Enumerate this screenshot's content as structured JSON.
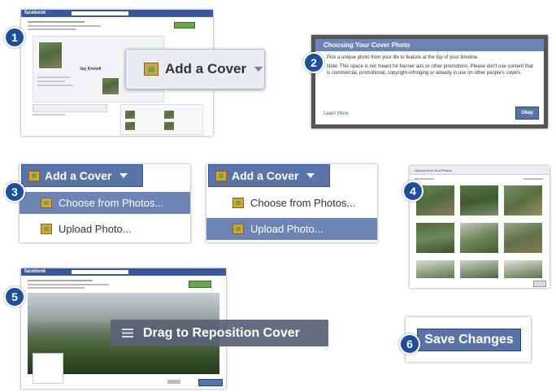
{
  "panel1": {
    "brand": "facebook",
    "add_cover_label": "Add a Cover",
    "profile_name": "Jay Kinnell"
  },
  "panel2": {
    "dialog_title": "Choosing Your Cover Photo",
    "dialog_text_1": "Pick a unique photo from your life to feature at the top of your timeline.",
    "dialog_text_2": "Note: This space is not meant for banner ads or other promotions. Please don't use content that is commercial, promotional, copyright-infringing or already in use on other people's covers.",
    "learn_more": "Learn More",
    "okay_label": "Okay"
  },
  "panel3": {
    "add_cover_label": "Add a Cover",
    "menu_items": [
      "Choose from Photos...",
      "Upload Photo..."
    ]
  },
  "panel4": {
    "title": "Choose from Your Photos"
  },
  "panel5": {
    "brand": "facebook",
    "drag_label": "Drag to Reposition Cover"
  },
  "panel6": {
    "save_label": "Save Changes"
  },
  "steps": [
    "1",
    "2",
    "3",
    "4",
    "5",
    "6"
  ],
  "colors": {
    "fb_blue": "#3b5998",
    "badge": "#1f4e9a",
    "menu_highlight": "#6d84b4",
    "save_button": "#5b74a8"
  }
}
